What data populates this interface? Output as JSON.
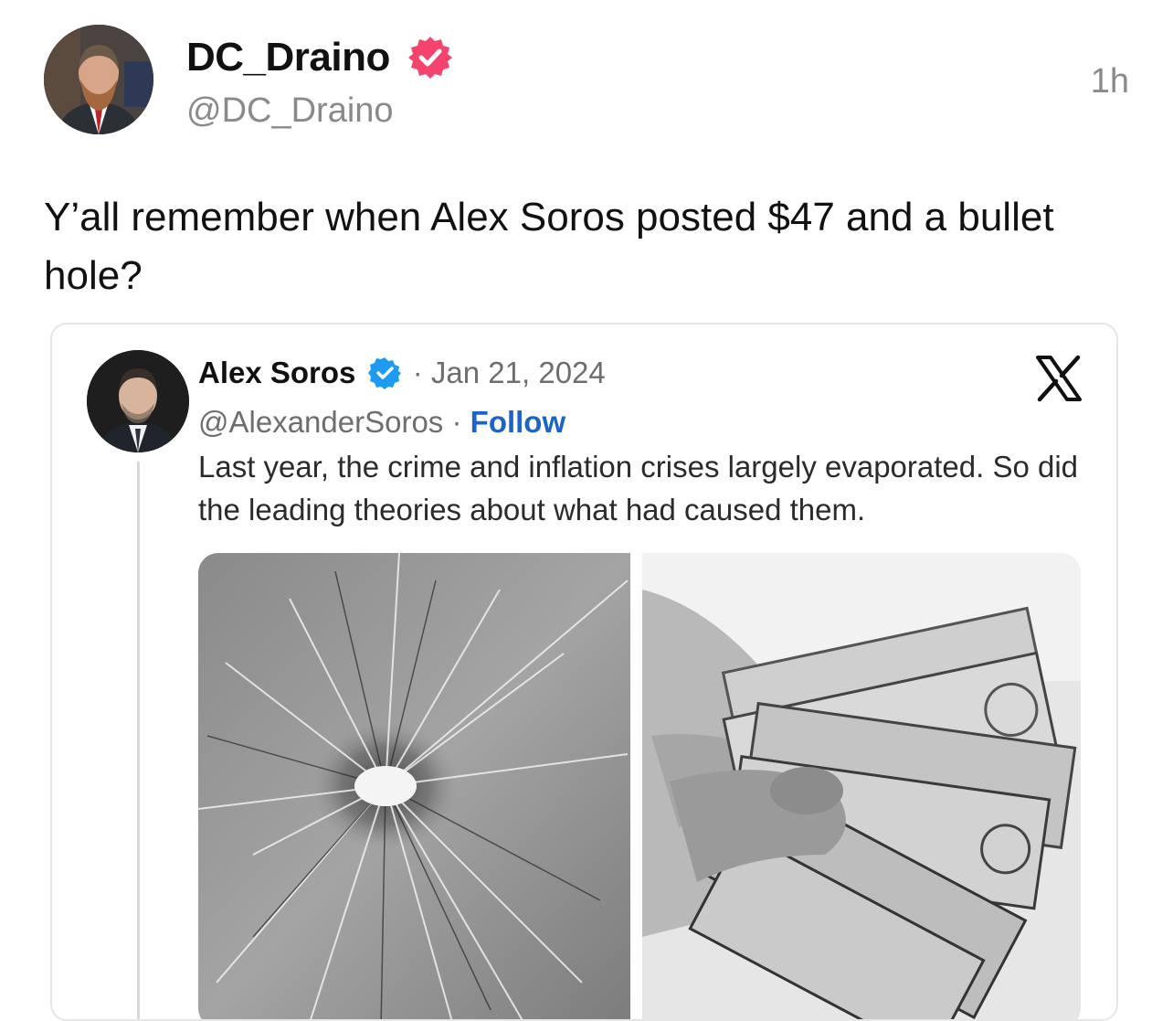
{
  "post": {
    "display_name": "DC_Draino",
    "handle": "@DC_Draino",
    "time": "1h",
    "text": "Y’all remember when Alex Soros posted $47 and a bullet hole?",
    "avatar": "man-with-beard-avatar",
    "verified_color": "#f4436c"
  },
  "embed": {
    "display_name": "Alex Soros",
    "separator": "·",
    "date": "Jan 21, 2024",
    "handle": "@AlexanderSoros",
    "follow_label": "Follow",
    "text": "Last year, the crime and inflation crises largely evaporated. So did the leading theories about what had caused them.",
    "verified_color": "#1d9bf0",
    "link_color": "#1d64c8",
    "media": [
      {
        "icon": "bullet-hole-glass-image"
      },
      {
        "icon": "hand-holding-dollar-bills-image"
      }
    ]
  }
}
